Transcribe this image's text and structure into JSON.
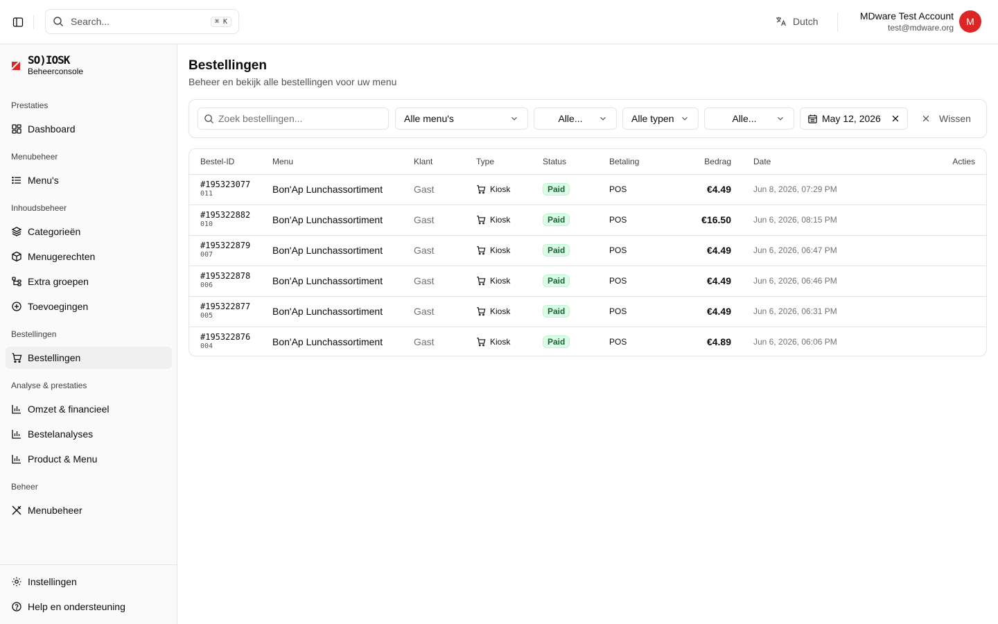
{
  "header": {
    "search_placeholder": "Search...",
    "search_shortcut": "⌘ K",
    "language": "Dutch",
    "user_name": "MDware Test Account",
    "user_email": "test@mdware.org",
    "avatar_initial": "M"
  },
  "brand": {
    "wordmark": "SO)IOSK",
    "subtitle": "Beheerconsole",
    "accent_color": "#dc2626"
  },
  "sidebar": {
    "groups": [
      {
        "label": "Prestaties",
        "items": [
          {
            "label": "Dashboard",
            "icon": "dashboard-icon"
          }
        ]
      },
      {
        "label": "Menubeheer",
        "items": [
          {
            "label": "Menu's",
            "icon": "list-icon"
          }
        ]
      },
      {
        "label": "Inhoudsbeheer",
        "items": [
          {
            "label": "Categorieën",
            "icon": "layers-icon"
          },
          {
            "label": "Menugerechten",
            "icon": "box-icon"
          },
          {
            "label": "Extra groepen",
            "icon": "tree-icon"
          },
          {
            "label": "Toevoegingen",
            "icon": "plus-circle-icon"
          }
        ]
      },
      {
        "label": "Bestellingen",
        "items": [
          {
            "label": "Bestellingen",
            "icon": "cart-icon",
            "active": true
          }
        ]
      },
      {
        "label": "Analyse & prestaties",
        "items": [
          {
            "label": "Omzet & financieel",
            "icon": "bar-chart-icon"
          },
          {
            "label": "Bestelanalyses",
            "icon": "bar-chart-icon"
          },
          {
            "label": "Product & Menu",
            "icon": "bar-chart-icon"
          }
        ]
      },
      {
        "label": "Beheer",
        "items": [
          {
            "label": "Menubeheer",
            "icon": "utensils-icon"
          }
        ]
      }
    ],
    "footer": [
      {
        "label": "Instellingen",
        "icon": "gear-icon"
      },
      {
        "label": "Help en ondersteuning",
        "icon": "help-icon"
      }
    ]
  },
  "page": {
    "title": "Bestellingen",
    "subtitle": "Beheer en bekijk alle bestellingen voor uw menu"
  },
  "filters": {
    "search_placeholder": "Zoek bestellingen...",
    "menu_select": "Alle menu's",
    "status_select": "Alle...",
    "type_select": "Alle typen",
    "payment_select": "Alle...",
    "date": "May 12, 2026",
    "clear_label": "Wissen"
  },
  "table": {
    "columns": [
      "Bestel-ID",
      "Menu",
      "Klant",
      "Type",
      "Status",
      "Betaling",
      "Bedrag",
      "Date",
      "Acties"
    ],
    "rows": [
      {
        "id": "#195323077",
        "seq": "011",
        "menu": "Bon'Ap Lunchassortiment",
        "klant": "Gast",
        "type": "Kiosk",
        "status": "Paid",
        "betaling": "POS",
        "bedrag": "€4.49",
        "date": "Jun 8, 2026, 07:29 PM"
      },
      {
        "id": "#195322882",
        "seq": "010",
        "menu": "Bon'Ap Lunchassortiment",
        "klant": "Gast",
        "type": "Kiosk",
        "status": "Paid",
        "betaling": "POS",
        "bedrag": "€16.50",
        "date": "Jun 6, 2026, 08:15 PM"
      },
      {
        "id": "#195322879",
        "seq": "007",
        "menu": "Bon'Ap Lunchassortiment",
        "klant": "Gast",
        "type": "Kiosk",
        "status": "Paid",
        "betaling": "POS",
        "bedrag": "€4.49",
        "date": "Jun 6, 2026, 06:47 PM"
      },
      {
        "id": "#195322878",
        "seq": "006",
        "menu": "Bon'Ap Lunchassortiment",
        "klant": "Gast",
        "type": "Kiosk",
        "status": "Paid",
        "betaling": "POS",
        "bedrag": "€4.49",
        "date": "Jun 6, 2026, 06:46 PM"
      },
      {
        "id": "#195322877",
        "seq": "005",
        "menu": "Bon'Ap Lunchassortiment",
        "klant": "Gast",
        "type": "Kiosk",
        "status": "Paid",
        "betaling": "POS",
        "bedrag": "€4.49",
        "date": "Jun 6, 2026, 06:31 PM"
      },
      {
        "id": "#195322876",
        "seq": "004",
        "menu": "Bon'Ap Lunchassortiment",
        "klant": "Gast",
        "type": "Kiosk",
        "status": "Paid",
        "betaling": "POS",
        "bedrag": "€4.89",
        "date": "Jun 6, 2026, 06:06 PM"
      }
    ]
  }
}
